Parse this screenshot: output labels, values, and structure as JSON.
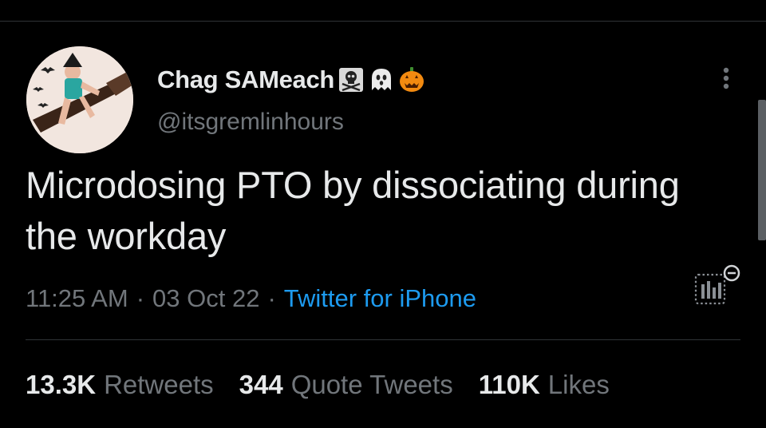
{
  "author": {
    "display_name": "Chag SAMeach",
    "handle": "@itsgremlinhours",
    "name_emojis": [
      "skull-crossbones-icon",
      "ghost-icon",
      "jack-o-lantern-icon"
    ]
  },
  "tweet": {
    "text": "Microdosing PTO by dissociating during the workday",
    "time": "11:25 AM",
    "separator_1": "·",
    "date": "03 Oct 22",
    "separator_2": "·",
    "source": "Twitter for iPhone"
  },
  "stats": [
    {
      "count": "13.3K",
      "label": "Retweets"
    },
    {
      "count": "344",
      "label": "Quote Tweets"
    },
    {
      "count": "110K",
      "label": "Likes"
    }
  ],
  "icons": {
    "more": "more-vertical-icon",
    "analytics": "tweet-analytics-icon"
  },
  "colors": {
    "background": "#000000",
    "primary_text": "#e7e9ea",
    "secondary_text": "#71767b",
    "link": "#1d9bf0",
    "divider": "#2f3336"
  }
}
